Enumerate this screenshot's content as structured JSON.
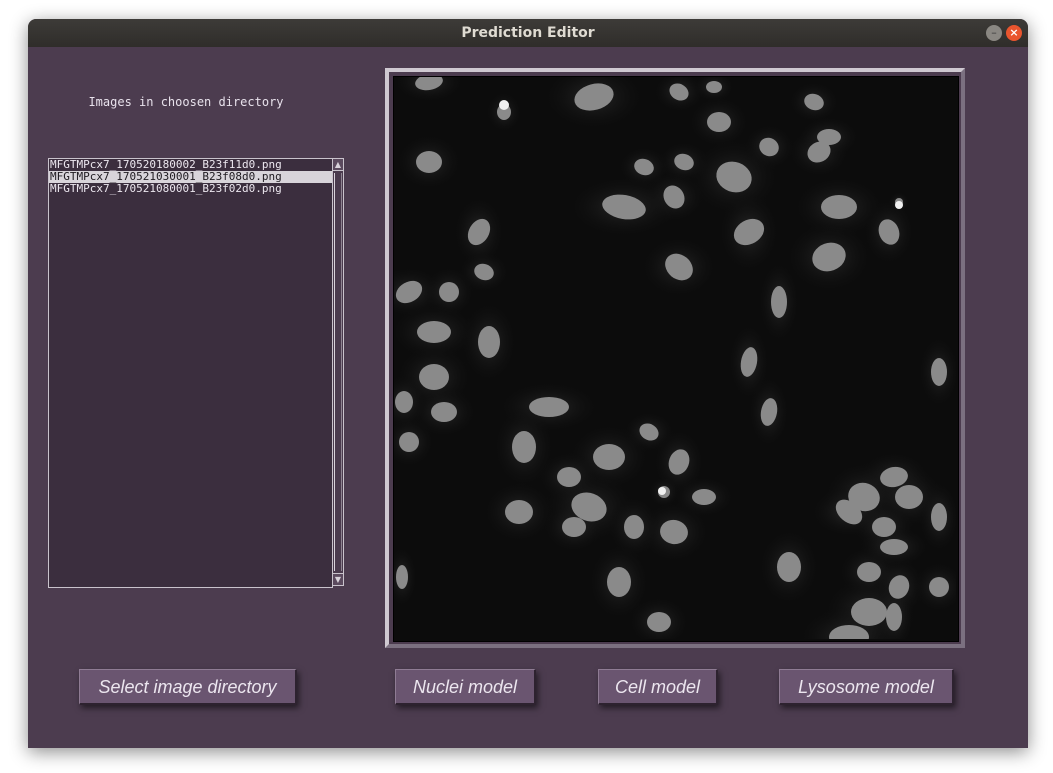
{
  "window": {
    "title": "Prediction Editor",
    "controls": {
      "minimize": "–",
      "close": "×"
    }
  },
  "directory_panel": {
    "label": "Images in choosen directory",
    "files": [
      {
        "name": "MFGTMPcx7_170520180002_B23f11d0.png",
        "selected": false
      },
      {
        "name": "MFGTMPcx7_170521030001_B23f08d0.png",
        "selected": true
      },
      {
        "name": "MFGTMPcx7_170521080001_B23f02d0.png",
        "selected": false
      }
    ],
    "scroll_up_glyph": "▲",
    "scroll_down_glyph": "▼"
  },
  "image_viewer": {
    "content": "grayscale fluorescence microscopy image of cell nuclei"
  },
  "buttons": {
    "select_dir": "Select image directory",
    "nuclei": "Nuclei model",
    "cell": "Cell model",
    "lysosome": "Lysosome model"
  },
  "colors": {
    "window_bg": "#4c3c4f",
    "titlebar": "#2f2d2a",
    "button_bg": "#6a5570",
    "close_button": "#e9552e"
  }
}
